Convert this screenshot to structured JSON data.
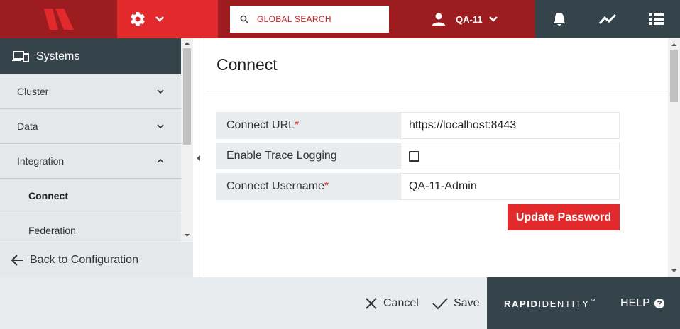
{
  "topbar": {
    "search_placeholder": "GLOBAL SEARCH",
    "user_name": "QA-11",
    "icons": [
      "logo-icon",
      "gear-icon",
      "chevron-down-icon",
      "search-icon",
      "user-icon",
      "bell-icon",
      "activity-icon",
      "list-icon"
    ]
  },
  "sidebar": {
    "header": "Systems",
    "items": [
      {
        "label": "Cluster",
        "expanded": false
      },
      {
        "label": "Data",
        "expanded": false
      },
      {
        "label": "Integration",
        "expanded": true
      },
      {
        "label": "Connect",
        "active": true
      },
      {
        "label": "Federation"
      }
    ],
    "back_label": "Back to Configuration"
  },
  "main": {
    "title": "Connect",
    "fields": [
      {
        "label": "Connect URL",
        "required_mark": "*",
        "value": "https://localhost:8443"
      },
      {
        "label": "Enable Trace Logging",
        "checked": false
      },
      {
        "label": "Connect Username",
        "required_mark": "*",
        "value": "QA-11-Admin"
      }
    ],
    "update_password_label": "Update Password"
  },
  "footer": {
    "cancel_label": "Cancel",
    "save_label": "Save",
    "brand_bold": "RAPID",
    "brand_light": "IDENTITY",
    "brand_tm": "™",
    "help_label": "HELP"
  },
  "colors": {
    "brand_red": "#e22a2c",
    "dark_red": "#9c1c20",
    "slate": "#35434b",
    "panel_gray": "#e9ecee"
  }
}
